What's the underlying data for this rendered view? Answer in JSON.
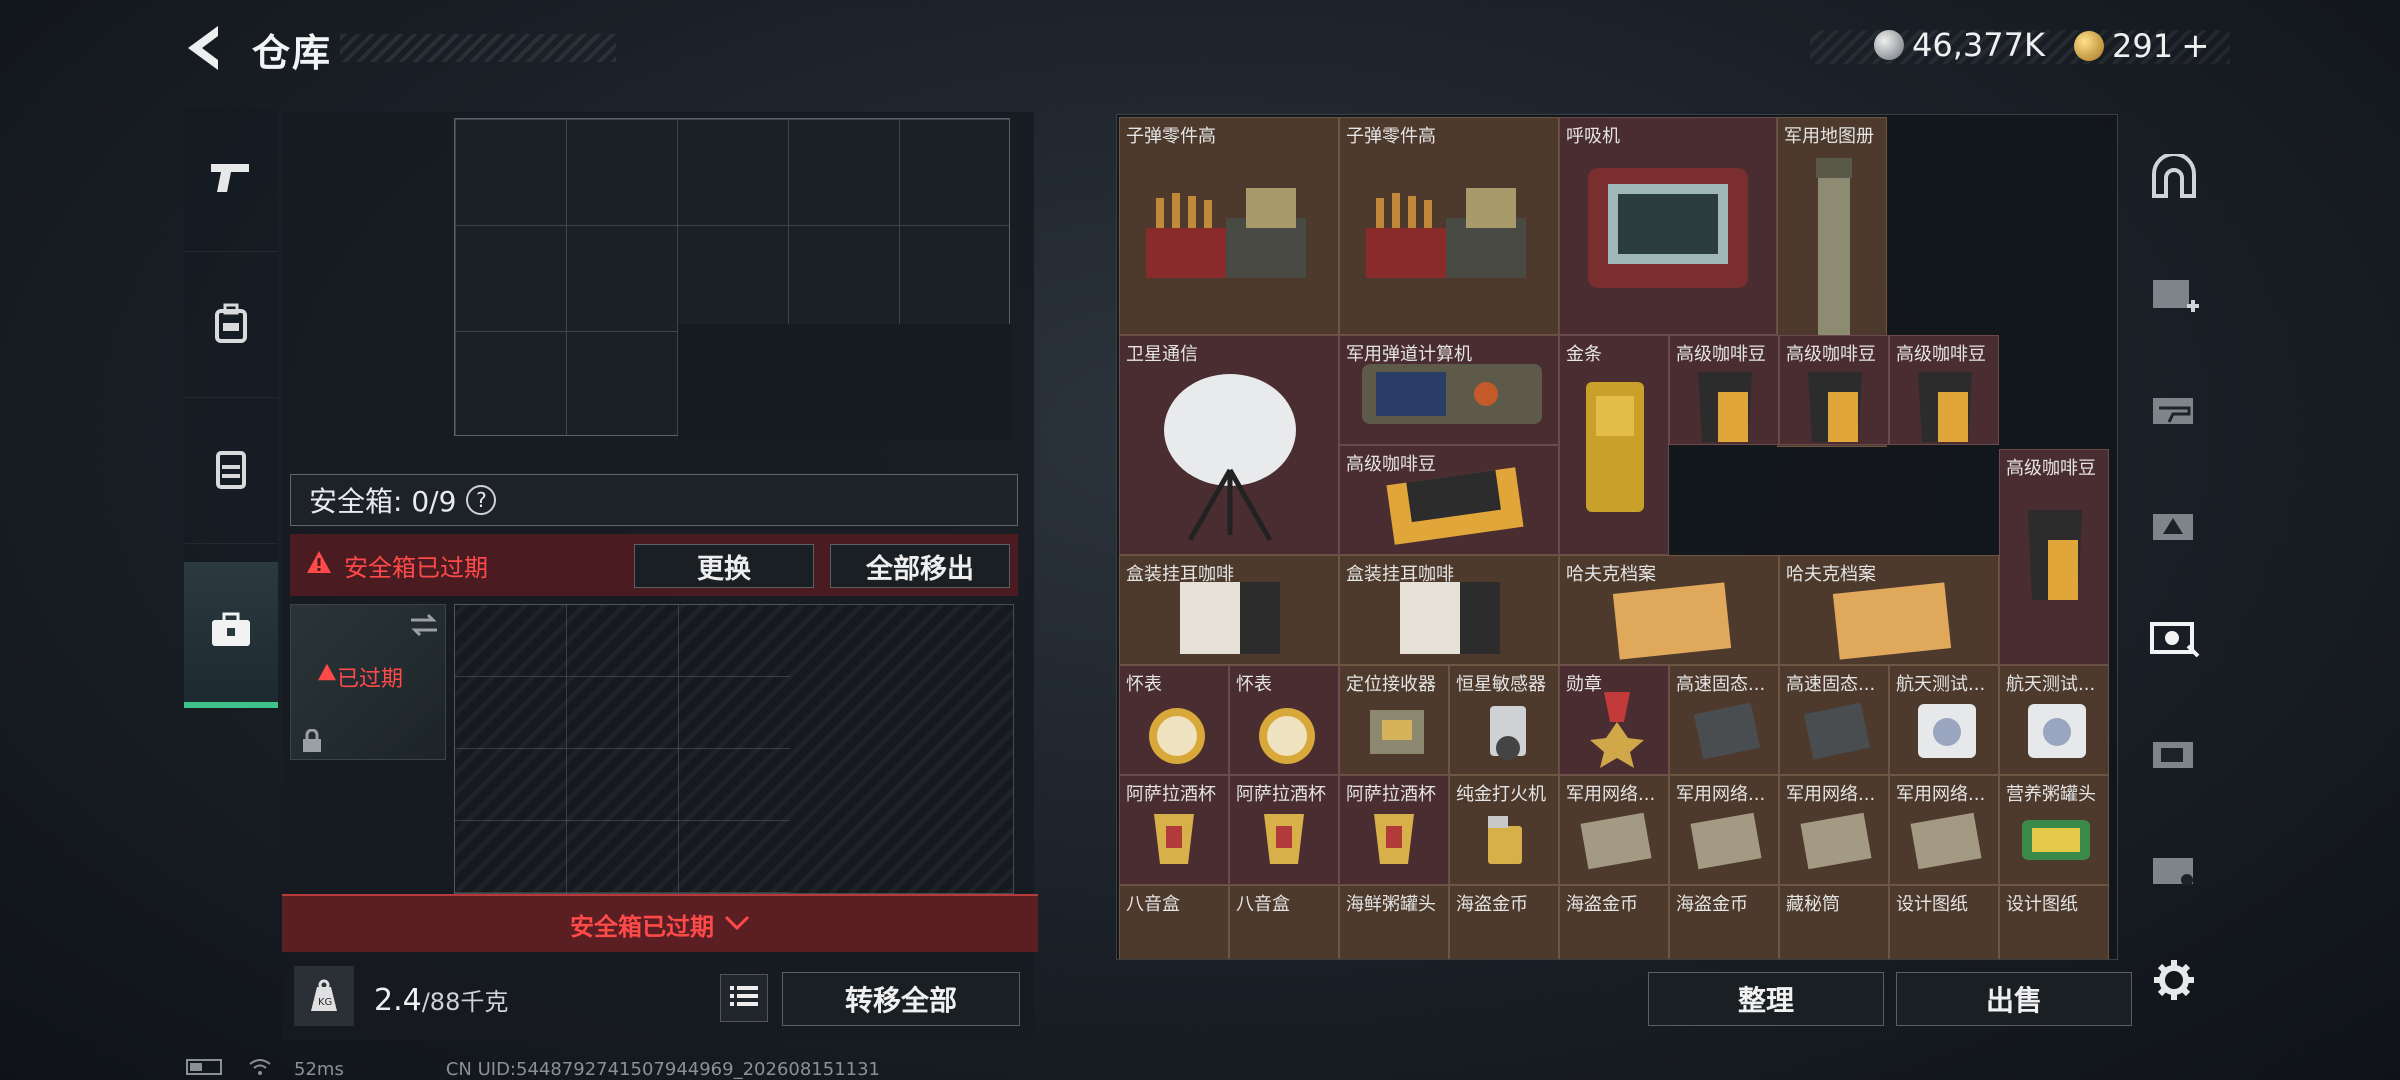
{
  "header": {
    "title": "仓库"
  },
  "currency": {
    "silver": "46,377K",
    "gold": "291",
    "gold_plus": "+"
  },
  "safe_box": {
    "capacity_label": "安全箱: 0/9",
    "help": "?",
    "expired_warning": "安全箱已过期",
    "replace_button": "更换",
    "remove_all_button": "全部移出",
    "case_status": "已过期",
    "bottom_expired": "安全箱已过期"
  },
  "weight": {
    "current": "2.4",
    "max": "/88千克"
  },
  "transfer_all_button": "转移全部",
  "inventory": {
    "items": [
      {
        "label": "子弹零件高"
      },
      {
        "label": "子弹零件高"
      },
      {
        "label": "呼吸机"
      },
      {
        "label": "军用地图册"
      },
      {
        "label": "卫星通信"
      },
      {
        "label": "军用弹道计算机"
      },
      {
        "label": "金条"
      },
      {
        "label": "高级咖啡豆"
      },
      {
        "label": "高级咖啡豆"
      },
      {
        "label": "高级咖啡豆"
      },
      {
        "label": "高级咖啡豆"
      },
      {
        "label": "高级咖啡豆"
      },
      {
        "label": "盒装挂耳咖啡"
      },
      {
        "label": "盒装挂耳咖啡"
      },
      {
        "label": "哈夫克档案"
      },
      {
        "label": "哈夫克档案"
      },
      {
        "label": "怀表"
      },
      {
        "label": "怀表"
      },
      {
        "label": "定位接收器"
      },
      {
        "label": "恒星敏感器"
      },
      {
        "label": "勋章"
      },
      {
        "label": "高速固态..."
      },
      {
        "label": "高速固态..."
      },
      {
        "label": "航天测试..."
      },
      {
        "label": "航天测试..."
      },
      {
        "label": "阿萨拉酒杯"
      },
      {
        "label": "阿萨拉酒杯"
      },
      {
        "label": "阿萨拉酒杯"
      },
      {
        "label": "纯金打火机"
      },
      {
        "label": "军用网络..."
      },
      {
        "label": "军用网络..."
      },
      {
        "label": "军用网络..."
      },
      {
        "label": "军用网络..."
      },
      {
        "label": "营养粥罐头"
      },
      {
        "label": "八音盒"
      },
      {
        "label": "八音盒"
      },
      {
        "label": "海鲜粥罐头"
      },
      {
        "label": "海盗金币"
      },
      {
        "label": "海盗金币"
      },
      {
        "label": "海盗金币"
      },
      {
        "label": "藏秘筒"
      },
      {
        "label": "设计图纸"
      },
      {
        "label": "设计图纸"
      }
    ]
  },
  "sort_button": "整理",
  "sell_button": "出售",
  "status": {
    "ping": "52ms",
    "uid": "CN UID:5448792741507944969_202608151131"
  }
}
